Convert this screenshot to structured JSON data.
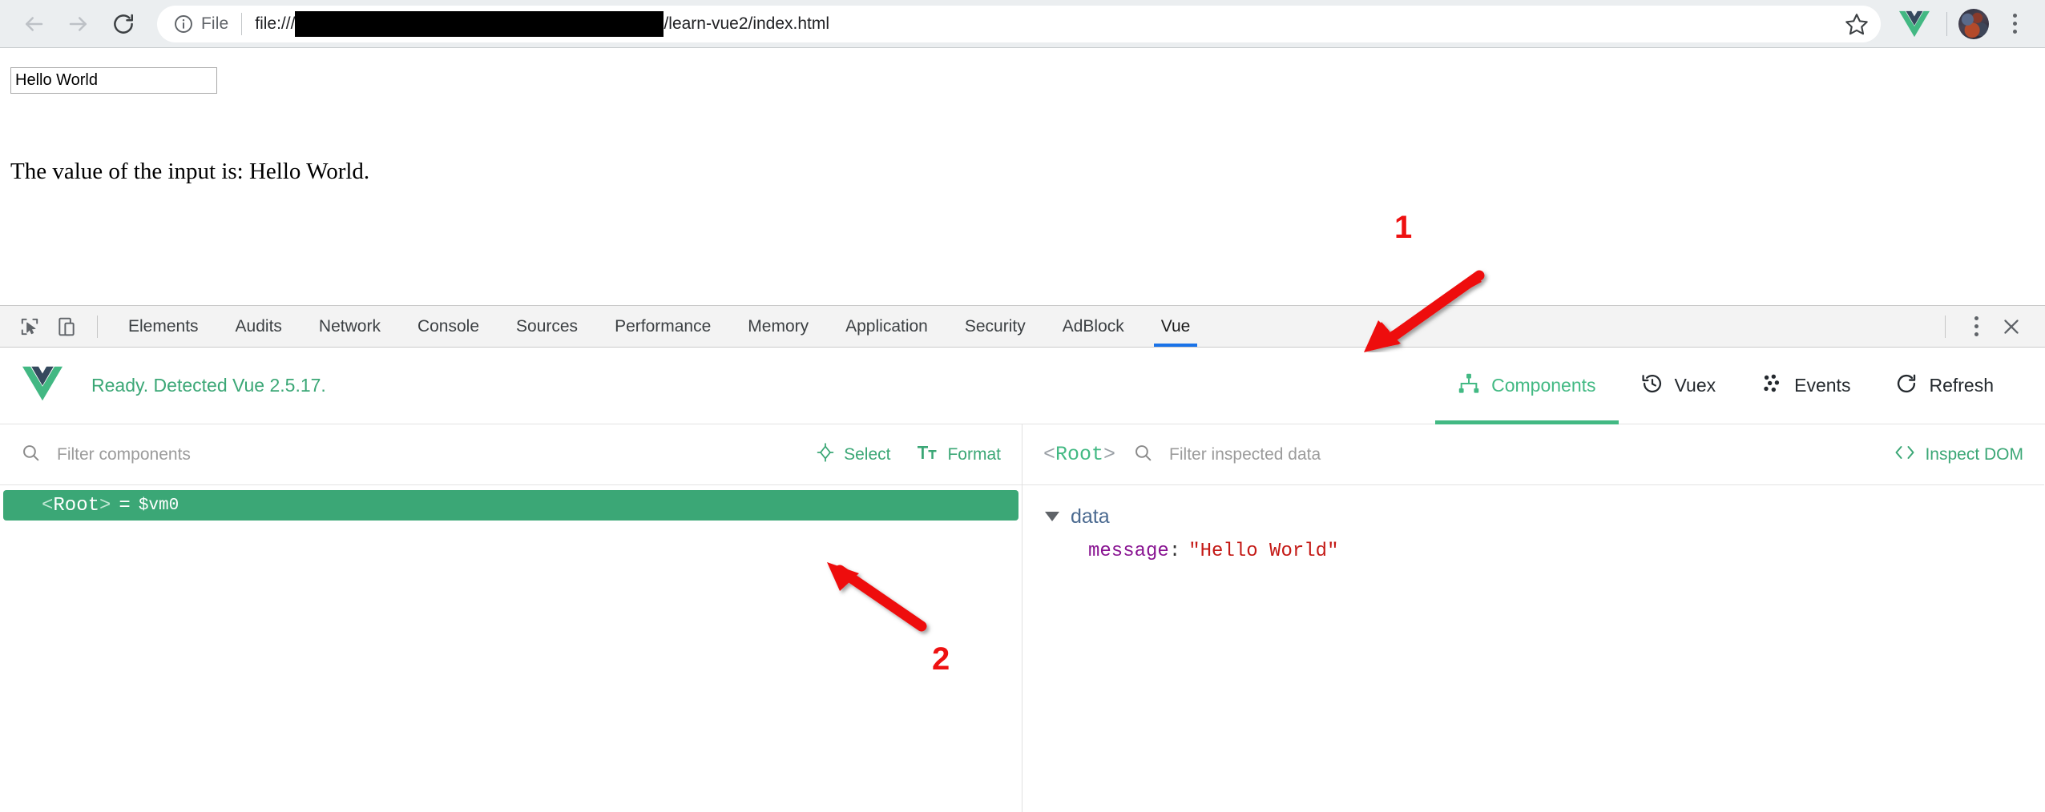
{
  "browser": {
    "back_icon": "arrow-left-icon",
    "forward_icon": "arrow-right-icon",
    "reload_icon": "reload-icon",
    "info_icon": "info-circle-icon",
    "security_label": "File",
    "url_scheme": "file:///",
    "url_redacted": "",
    "url_tail": "/learn-vue2/index.html",
    "bookmark_icon": "star-icon",
    "extension_icon": "vue-extension-icon",
    "avatar_icon": "avatar",
    "menu_icon": "kebab-menu-icon"
  },
  "page": {
    "input_value": "Hello World",
    "paragraph": "The value of the input is: Hello World."
  },
  "devtools": {
    "inspect_icon": "inspect-element-icon",
    "device_icon": "device-toolbar-icon",
    "tabs": [
      {
        "label": "Elements",
        "active": false
      },
      {
        "label": "Audits",
        "active": false
      },
      {
        "label": "Network",
        "active": false
      },
      {
        "label": "Console",
        "active": false
      },
      {
        "label": "Sources",
        "active": false
      },
      {
        "label": "Performance",
        "active": false
      },
      {
        "label": "Memory",
        "active": false
      },
      {
        "label": "Application",
        "active": false
      },
      {
        "label": "Security",
        "active": false
      },
      {
        "label": "AdBlock",
        "active": false
      },
      {
        "label": "Vue",
        "active": true
      }
    ],
    "more_icon": "kebab-menu-icon",
    "close_icon": "close-icon",
    "active_tab_underline_color": "#1a73e8"
  },
  "vue_devtools": {
    "logo_icon": "vue-logo-icon",
    "status": "Ready. Detected Vue 2.5.17.",
    "status_color": "#3ba776",
    "nav": [
      {
        "label": "Components",
        "icon": "component-tree-icon",
        "active": true
      },
      {
        "label": "Vuex",
        "icon": "history-clock-icon",
        "active": false
      },
      {
        "label": "Events",
        "icon": "events-dots-icon",
        "active": false
      },
      {
        "label": "Refresh",
        "icon": "refresh-icon",
        "active": false
      }
    ],
    "accent_color": "#42b983"
  },
  "components_panel": {
    "search_icon": "search-icon",
    "filter_placeholder": "Filter components",
    "filter_value": "",
    "select_label": "Select",
    "select_icon": "target-crosshair-icon",
    "format_label": "Format",
    "format_icon": "text-format-icon",
    "tree": [
      {
        "open_bracket": "<",
        "name": "Root",
        "close_bracket": ">",
        "equals": "=",
        "instance": "$vm0",
        "selected": true
      }
    ],
    "selected_row_color": "#3ba776"
  },
  "inspector_panel": {
    "root_open": "<",
    "root_name": "Root",
    "root_close": ">",
    "search_icon": "search-icon",
    "filter_placeholder": "Filter inspected data",
    "filter_value": "",
    "inspect_dom_label": "Inspect DOM",
    "inspect_dom_icon": "code-brackets-icon",
    "groups": [
      {
        "title": "data",
        "expanded": true,
        "entries": [
          {
            "key": "message",
            "colon": ":",
            "value": "\"Hello World\"",
            "type": "string"
          }
        ]
      }
    ]
  },
  "annotations": [
    {
      "number": "1",
      "target": "vue-tab",
      "arrow": "points-down-left"
    },
    {
      "number": "2",
      "target": "root-component-row",
      "arrow": "points-up-left"
    }
  ]
}
